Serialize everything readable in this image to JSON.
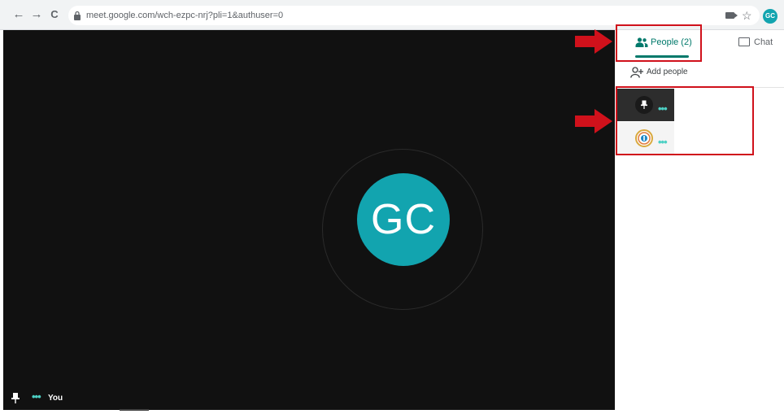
{
  "browser": {
    "url": "meet.google.com/wch-ezpc-nrj?pli=1&authuser=0",
    "profile_initials": "GC",
    "icons": [
      "back-icon",
      "forward-icon",
      "reload-icon",
      "lock-icon",
      "camera-icon",
      "star-icon"
    ],
    "back_glyph": "←",
    "forward_glyph": "→",
    "reload_glyph": "C",
    "star_glyph": "☆"
  },
  "stage": {
    "avatar_initials": "GC",
    "self_label": "You",
    "dots": "•••"
  },
  "panel": {
    "tabs": [
      {
        "label": "People (2)",
        "active": true
      },
      {
        "label": "Chat",
        "active": false
      }
    ],
    "add_people_label": "Add people",
    "participants": [
      {
        "avatar": "pin-icon",
        "dots": "•••",
        "highlighted": true
      },
      {
        "avatar": "app-logo",
        "dots": "•••",
        "highlighted": false
      }
    ]
  },
  "colors": {
    "accent": "#00796b",
    "avatar_bg": "#12a4af",
    "annotation_red": "#d0111b",
    "stage_bg": "#111111"
  }
}
